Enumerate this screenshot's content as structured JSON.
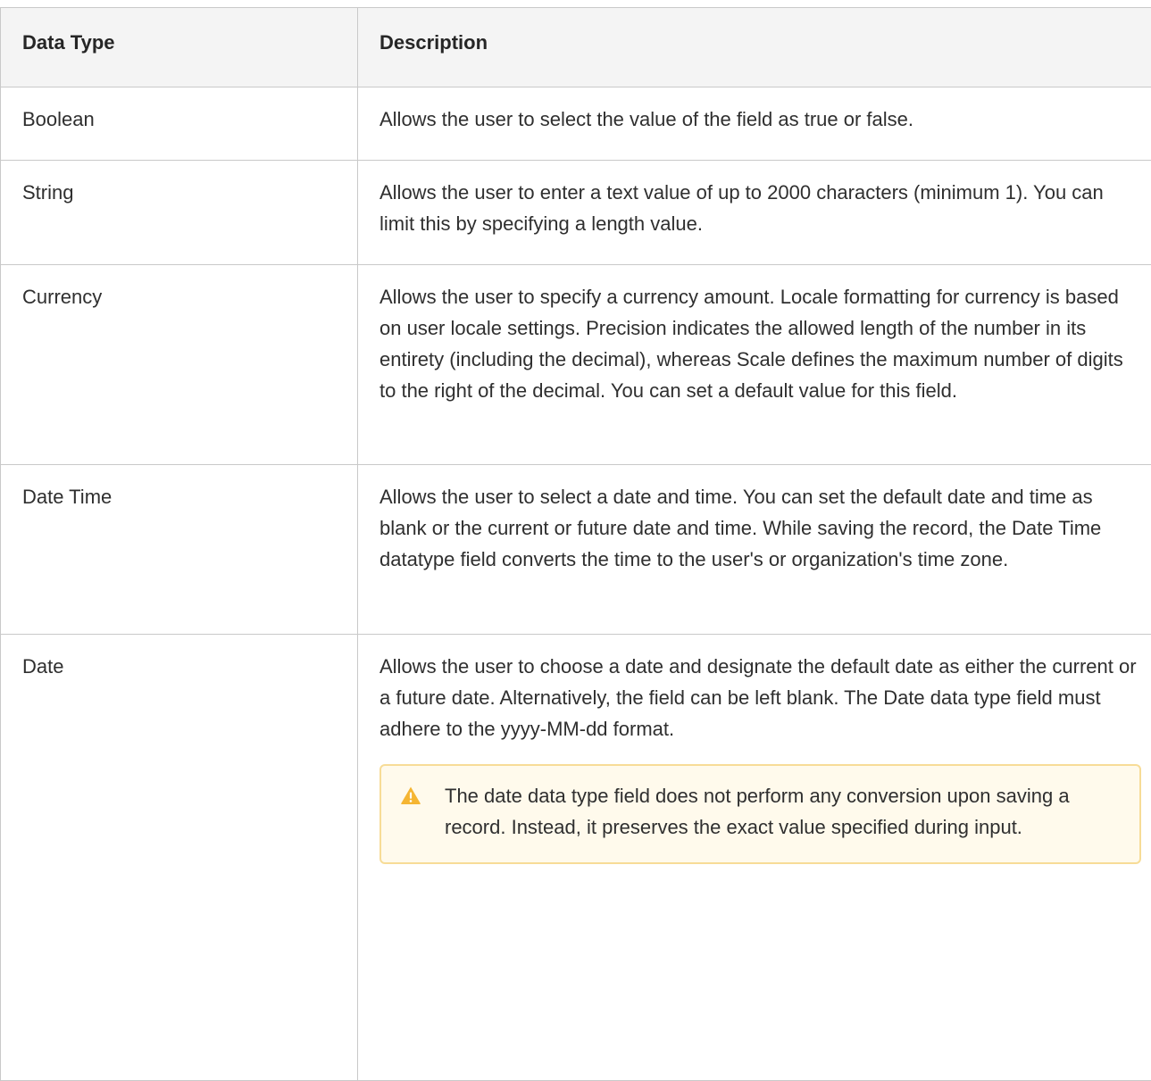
{
  "table": {
    "headers": {
      "type": "Data Type",
      "description": "Description"
    },
    "rows": [
      {
        "type": "Boolean",
        "description": "Allows the user to select the value of the field as true or false."
      },
      {
        "type": "String",
        "description": "Allows the user to enter a text value of up to 2000 characters (minimum 1). You can limit this by specifying a length value."
      },
      {
        "type": "Currency",
        "description": "Allows the user to specify a currency amount. Locale formatting for currency is based on user locale settings. Precision indicates the allowed length of the number in its entirety (including the decimal), whereas Scale defines the maximum number of digits to the right of the decimal. You can set a default value for this field."
      },
      {
        "type": "Date Time",
        "description": "Allows the user to select a date and time. You can set the default date and time as blank or the current or future date and time. While saving the record, the Date Time datatype field converts the time to the user's or organization's time zone."
      },
      {
        "type": "Date",
        "description": "Allows the user to choose a date and designate the default date as either the current or a future date. Alternatively, the field can be left blank. The Date data type field must adhere to the yyyy-MM-dd format.",
        "note": {
          "icon": "warning-icon",
          "text": "The date data type field does not perform any conversion upon saving a record. Instead, it preserves the exact value specified during input."
        }
      }
    ]
  },
  "colors": {
    "header_bg": "#f4f4f4",
    "border": "#c9c9c9",
    "note_bg": "#fffaec",
    "note_border": "#f7dc97",
    "warning_icon": "#f5b532"
  }
}
